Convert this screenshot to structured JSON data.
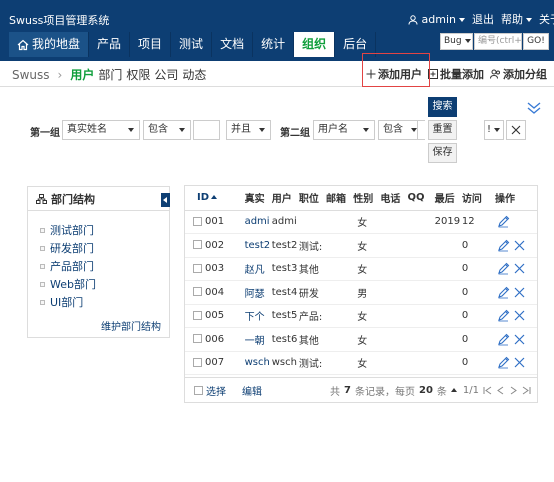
{
  "app": {
    "title": "Swuss项目管理系统"
  },
  "user_menu": {
    "user": "admin",
    "logout": "退出",
    "help": "帮助",
    "switch": "关于"
  },
  "nav": {
    "tabs": [
      {
        "label": "我的地盘"
      },
      {
        "label": "产品"
      },
      {
        "label": "项目"
      },
      {
        "label": "测试"
      },
      {
        "label": "文档"
      },
      {
        "label": "统计"
      },
      {
        "label": "组织",
        "active": true
      },
      {
        "label": "后台"
      }
    ]
  },
  "quickjump": {
    "type": "Bug",
    "placeholder": "编号(ctrl+g)",
    "go": "GO!"
  },
  "breadcrumb": {
    "root": "Swuss"
  },
  "subnav": {
    "items": [
      "用户",
      "部门",
      "权限",
      "公司",
      "动态"
    ],
    "actions": [
      "添加用户",
      "批量添加",
      "添加分组"
    ]
  },
  "search": {
    "group1_label": "第一组",
    "group1_field": "真实姓名",
    "group1_op": "包含",
    "logic": "并且",
    "group2_label": "第二组",
    "group2_field": "用户名",
    "group2_op": "包含",
    "search_btn": "搜索",
    "reset_btn": "重置",
    "save_btn": "保存"
  },
  "dept": {
    "title": "部门结构",
    "items": [
      "测试部门",
      "研发部门",
      "产品部门",
      "Web部门",
      "UI部门"
    ],
    "maintain": "维护部门结构"
  },
  "table": {
    "headers": [
      "ID",
      "真实",
      "用户",
      "职位",
      "邮箱",
      "性别",
      "电话",
      "QQ",
      "最后",
      "访问",
      "操作"
    ],
    "rows": [
      {
        "id": "001",
        "realname": "admi",
        "username": "admi",
        "role": "",
        "gender": "女",
        "last": "2019",
        "visits": "12"
      },
      {
        "id": "002",
        "realname": "test2",
        "username": "test2",
        "role": "测试:",
        "gender": "女",
        "last": "",
        "visits": "0"
      },
      {
        "id": "003",
        "realname": "赵凡",
        "username": "test3",
        "role": "其他",
        "gender": "女",
        "last": "",
        "visits": "0"
      },
      {
        "id": "004",
        "realname": "阿瑟",
        "username": "test4",
        "role": "研发",
        "gender": "男",
        "last": "",
        "visits": "0"
      },
      {
        "id": "005",
        "realname": "下个",
        "username": "test5",
        "role": "产品:",
        "gender": "女",
        "last": "",
        "visits": "0"
      },
      {
        "id": "006",
        "realname": "一朝",
        "username": "test6",
        "role": "其他",
        "gender": "女",
        "last": "",
        "visits": "0"
      },
      {
        "id": "007",
        "realname": "wsch",
        "username": "wsch",
        "role": "测试:",
        "gender": "女",
        "last": "",
        "visits": "0"
      }
    ],
    "footer": {
      "select": "选择",
      "edit": "编辑",
      "total_pre": "共",
      "total": "7",
      "total_post": "条记录，每页",
      "per_page": "20",
      "per_page_post": "条",
      "page": "1/1"
    }
  },
  "colors": {
    "header_bg": "#0d3e73",
    "accent_green": "#0f9e3b",
    "link_blue": "#0d3e73",
    "highlight_red": "#e24444"
  }
}
